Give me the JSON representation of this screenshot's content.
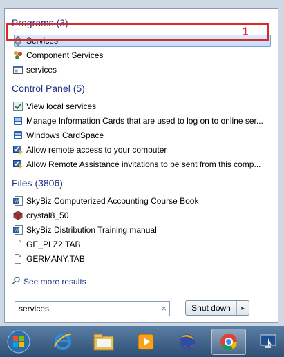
{
  "sections": {
    "programs": "Programs (3)",
    "control_panel": "Control Panel (5)",
    "files": "Files (3806)"
  },
  "programs": [
    {
      "label": "Services",
      "icon": "services-gear-icon"
    },
    {
      "label": "Component Services",
      "icon": "component-services-icon"
    },
    {
      "label": "services",
      "icon": "console-icon"
    }
  ],
  "control_panel": [
    {
      "label": "View local services",
      "icon": "services-check-icon"
    },
    {
      "label": "Manage Information Cards that are used to log on to online ser...",
      "icon": "cardspace-icon"
    },
    {
      "label": "Windows CardSpace",
      "icon": "cardspace-icon"
    },
    {
      "label": "Allow remote access to your computer",
      "icon": "remote-shield-icon"
    },
    {
      "label": "Allow Remote Assistance invitations to be sent from this comp...",
      "icon": "remote-shield-icon"
    }
  ],
  "files": [
    {
      "label": "SkyBiz Computerized Accounting Course Book",
      "icon": "word-doc-icon"
    },
    {
      "label": "crystal8_50",
      "icon": "crystal-cube-icon"
    },
    {
      "label": "SkyBiz Distribution Training manual",
      "icon": "word-doc-icon"
    },
    {
      "label": "GE_PLZ2.TAB",
      "icon": "blank-file-icon"
    },
    {
      "label": "GERMANY.TAB",
      "icon": "blank-file-icon"
    }
  ],
  "see_more": "See more results",
  "search": {
    "value": "services",
    "clear": "×"
  },
  "shutdown": {
    "label": "Shut down",
    "arrow": "▸"
  },
  "annotation": "1",
  "colors": {
    "highlight_box": "#d62b2b",
    "section_text": "#1e3287"
  }
}
